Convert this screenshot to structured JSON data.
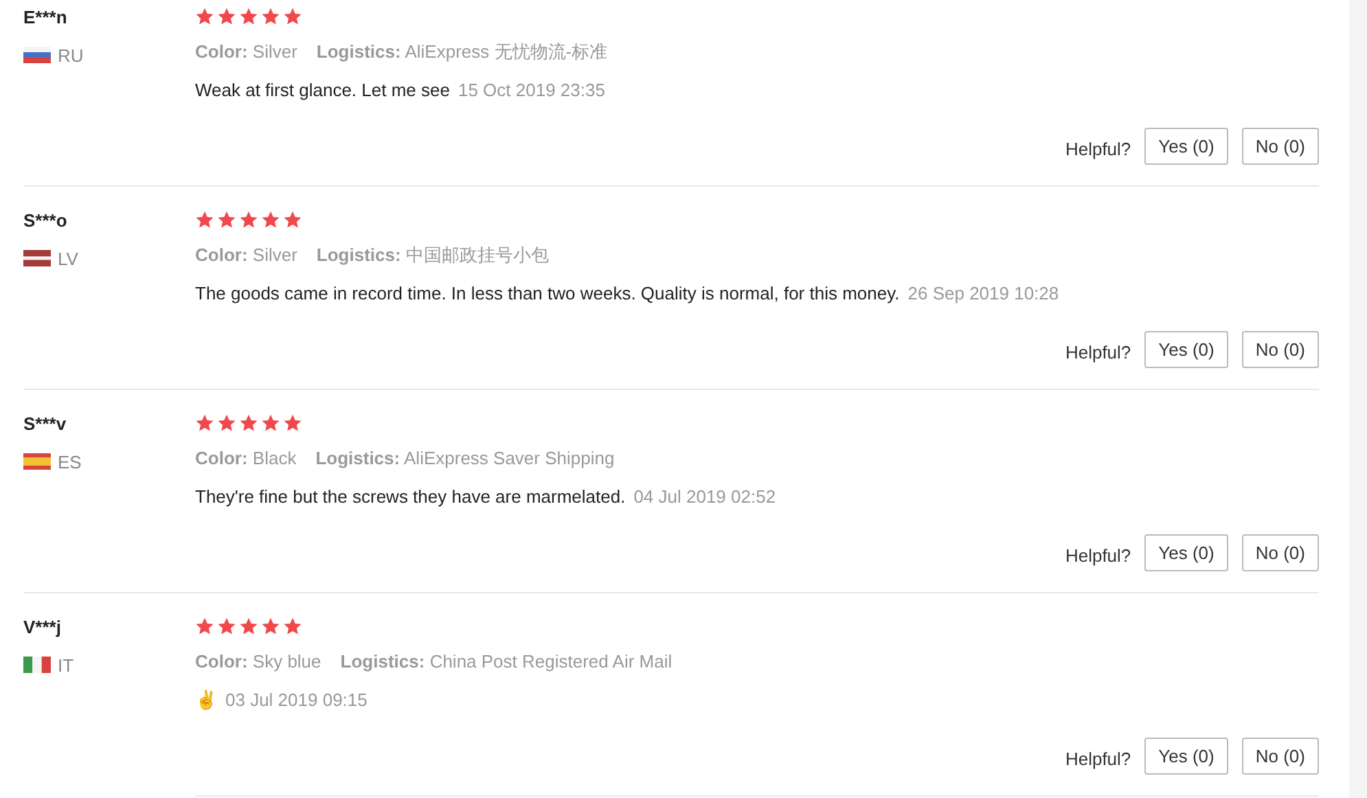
{
  "reviews": [
    {
      "name": "E***n",
      "flag": {
        "kind": "ru"
      },
      "country": "RU",
      "stars": 5,
      "variant_label": "Color:",
      "variant": "Silver",
      "logistics_label": "Logistics:",
      "logistics": "AliExpress 无忧物流-标准",
      "comment": "Weak at first glance. Let me see",
      "date": "15 Oct 2019 23:35",
      "helpful_label": "Helpful?",
      "yes": "Yes (0)",
      "no": "No (0)"
    },
    {
      "name": "S***o",
      "flag": {
        "kind": "lv"
      },
      "country": "LV",
      "stars": 5,
      "variant_label": "Color:",
      "variant": "Silver",
      "logistics_label": "Logistics:",
      "logistics": "中国邮政挂号小包",
      "comment": "The goods came in record time. In less than two weeks. Quality is normal, for this money.",
      "date": "26 Sep 2019 10:28",
      "helpful_label": "Helpful?",
      "yes": "Yes (0)",
      "no": "No (0)"
    },
    {
      "name": "S***v",
      "flag": {
        "kind": "es"
      },
      "country": "ES",
      "stars": 5,
      "variant_label": "Color:",
      "variant": "Black",
      "logistics_label": "Logistics:",
      "logistics": "AliExpress Saver Shipping",
      "comment": "They're fine but the screws they have are marmelated.",
      "date": "04 Jul 2019 02:52",
      "helpful_label": "Helpful?",
      "yes": "Yes (0)",
      "no": "No (0)"
    },
    {
      "name": "V***j",
      "flag": {
        "kind": "it"
      },
      "country": "IT",
      "stars": 5,
      "variant_label": "Color:",
      "variant": "Sky blue",
      "logistics_label": "Logistics:",
      "logistics": "China Post Registered Air Mail",
      "comment": "✌",
      "date": "03 Jul 2019 09:15",
      "helpful_label": "Helpful?",
      "yes": "Yes (0)",
      "no": "No (0)"
    }
  ]
}
